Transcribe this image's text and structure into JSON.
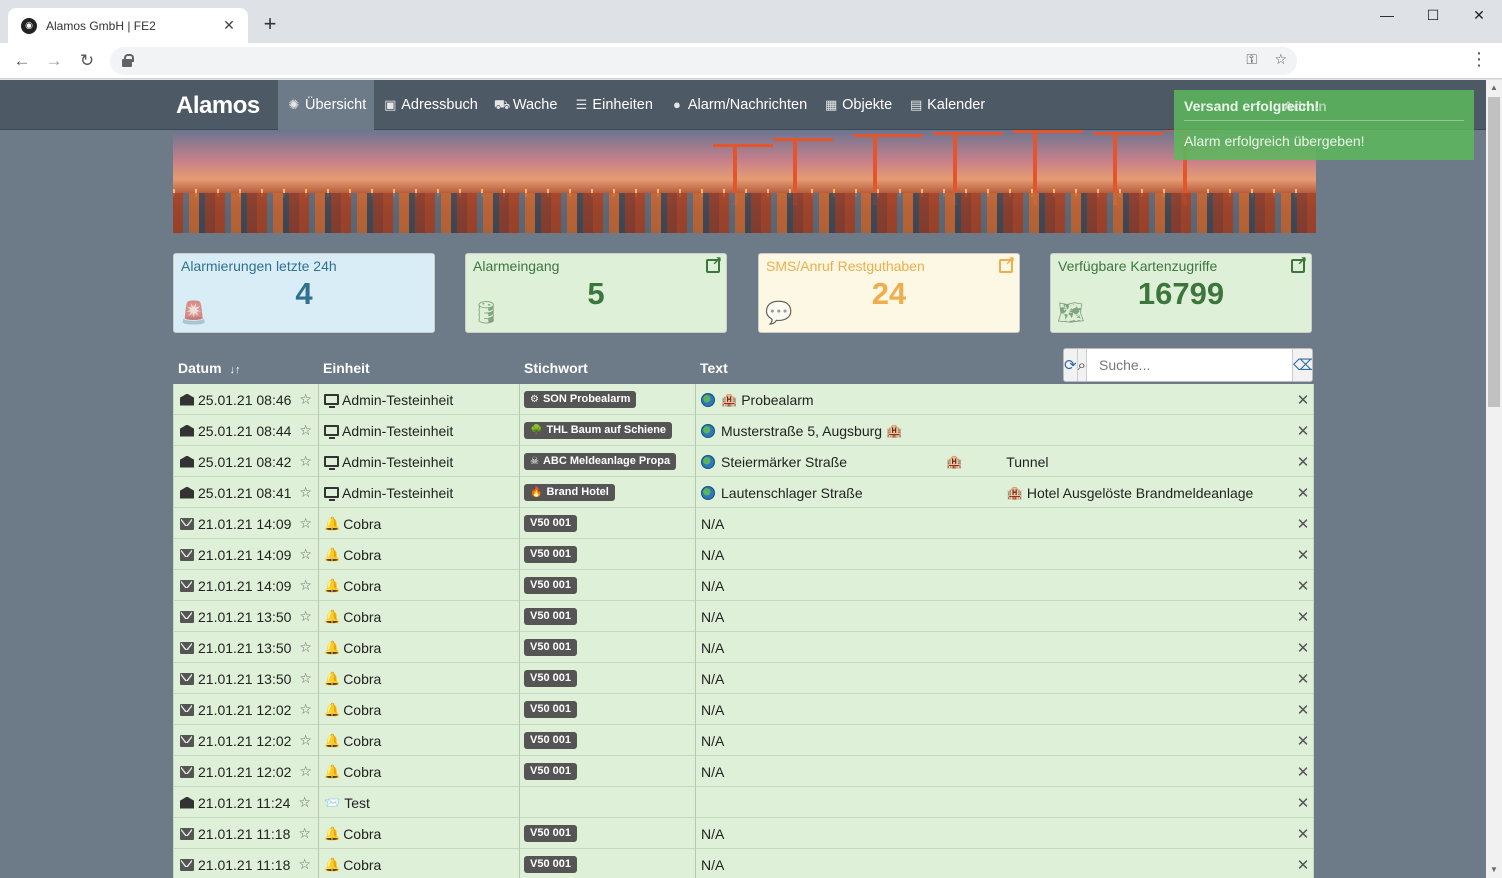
{
  "browser": {
    "tab_title": "Alamos GmbH | FE2",
    "new_tab": "+",
    "minimize": "—",
    "maximize": "☐",
    "close": "✕"
  },
  "app": {
    "brand": "Alamos",
    "nav": [
      {
        "label": "Übersicht",
        "icon": "alarm-light-icon",
        "active": true
      },
      {
        "label": "Adressbuch",
        "icon": "contact-book-icon"
      },
      {
        "label": "Wache",
        "icon": "fire-truck-icon"
      },
      {
        "label": "Einheiten",
        "icon": "list-icon"
      },
      {
        "label": "Alarm/Nachrichten",
        "icon": "chat-icon"
      },
      {
        "label": "Objekte",
        "icon": "building-icon"
      },
      {
        "label": "Kalender",
        "icon": "calendar-icon"
      }
    ],
    "admin_label": "Admin",
    "toast": {
      "title": "Versand erfolgreich!",
      "message": "Alarm erfolgreich übergeben!"
    }
  },
  "panels": [
    {
      "label": "Alarmierungen letzte 24h",
      "value": "4",
      "bg": "#d9edf7",
      "fg": "#31708f",
      "icon": "siren-icon",
      "link": false
    },
    {
      "label": "Alarmeingang",
      "value": "5",
      "bg": "#dff0d8",
      "fg": "#3c763d",
      "icon": "database-icon",
      "link": true
    },
    {
      "label": "SMS/Anruf Restguthaben",
      "value": "24",
      "bg": "#fcf8e3",
      "fg": "#f0ad4e",
      "icon": "money-chat-icon",
      "link": true
    },
    {
      "label": "Verfügbare Kartenzugriffe",
      "value": "16799",
      "bg": "#dff0d8",
      "fg": "#3c763d",
      "icon": "map-icon",
      "link": true
    }
  ],
  "table": {
    "headers": {
      "date": "Datum",
      "sort": "↓↑",
      "unit": "Einheit",
      "keyword": "Stichwort",
      "text": "Text"
    },
    "search_placeholder": "Suche...",
    "rows": [
      {
        "type": "open",
        "date": "25.01.21 08:46",
        "unit_icon": "monitor",
        "unit": "Admin-Testeinheit",
        "kw_icon": "⚙",
        "keyword": "SON Probealarm",
        "globe": true,
        "text_a": "Probealarm",
        "bldg_before": true,
        "text_b": "",
        "gap": 0
      },
      {
        "type": "open",
        "date": "25.01.21 08:44",
        "unit_icon": "monitor",
        "unit": "Admin-Testeinheit",
        "kw_icon": "🌳",
        "keyword": "THL Baum auf Schiene",
        "globe": true,
        "text_a": "Musterstraße 5, Augsburg",
        "bldg_after": true,
        "text_b": "",
        "gap": 0
      },
      {
        "type": "open",
        "date": "25.01.21 08:42",
        "unit_icon": "monitor",
        "unit": "Admin-Testeinheit",
        "kw_icon": "☠",
        "keyword": "ABC Meldeanlage Propa",
        "globe": true,
        "text_a": "Steiermärker Straße",
        "bldg_mid": true,
        "text_b": "Tunnel",
        "gap": 1
      },
      {
        "type": "open",
        "date": "25.01.21 08:41",
        "unit_icon": "monitor",
        "unit": "Admin-Testeinheit",
        "kw_icon": "🔥",
        "keyword": "Brand Hotel",
        "globe": true,
        "text_a": "Lautenschlager Straße",
        "bldg_mid": true,
        "text_b": "Hotel Ausgelöste Brandmeldeanlage",
        "gap": 2
      },
      {
        "type": "mail",
        "date": "21.01.21 14:09",
        "unit_icon": "bell",
        "unit": "Cobra",
        "kw_icon": "",
        "keyword": "V50 001",
        "globe": false,
        "text_a": "N/A",
        "text_b": ""
      },
      {
        "type": "mail",
        "date": "21.01.21 14:09",
        "unit_icon": "bell",
        "unit": "Cobra",
        "kw_icon": "",
        "keyword": "V50 001",
        "globe": false,
        "text_a": "N/A",
        "text_b": ""
      },
      {
        "type": "mail",
        "date": "21.01.21 14:09",
        "unit_icon": "bell",
        "unit": "Cobra",
        "kw_icon": "",
        "keyword": "V50 001",
        "globe": false,
        "text_a": "N/A",
        "text_b": ""
      },
      {
        "type": "mail",
        "date": "21.01.21 13:50",
        "unit_icon": "bell",
        "unit": "Cobra",
        "kw_icon": "",
        "keyword": "V50 001",
        "globe": false,
        "text_a": "N/A",
        "text_b": ""
      },
      {
        "type": "mail",
        "date": "21.01.21 13:50",
        "unit_icon": "bell",
        "unit": "Cobra",
        "kw_icon": "",
        "keyword": "V50 001",
        "globe": false,
        "text_a": "N/A",
        "text_b": ""
      },
      {
        "type": "mail",
        "date": "21.01.21 13:50",
        "unit_icon": "bell",
        "unit": "Cobra",
        "kw_icon": "",
        "keyword": "V50 001",
        "globe": false,
        "text_a": "N/A",
        "text_b": ""
      },
      {
        "type": "mail",
        "date": "21.01.21 12:02",
        "unit_icon": "bell",
        "unit": "Cobra",
        "kw_icon": "",
        "keyword": "V50 001",
        "globe": false,
        "text_a": "N/A",
        "text_b": ""
      },
      {
        "type": "mail",
        "date": "21.01.21 12:02",
        "unit_icon": "bell",
        "unit": "Cobra",
        "kw_icon": "",
        "keyword": "V50 001",
        "globe": false,
        "text_a": "N/A",
        "text_b": ""
      },
      {
        "type": "mail",
        "date": "21.01.21 12:02",
        "unit_icon": "bell",
        "unit": "Cobra",
        "kw_icon": "",
        "keyword": "V50 001",
        "globe": false,
        "text_a": "N/A",
        "text_b": ""
      },
      {
        "type": "open",
        "date": "21.01.21 11:24",
        "unit_icon": "test",
        "unit": "Test",
        "kw_icon": "",
        "keyword": "",
        "globe": false,
        "text_a": "",
        "text_b": ""
      },
      {
        "type": "mail",
        "date": "21.01.21 11:18",
        "unit_icon": "bell",
        "unit": "Cobra",
        "kw_icon": "",
        "keyword": "V50 001",
        "globe": false,
        "text_a": "N/A",
        "text_b": ""
      },
      {
        "type": "mail",
        "date": "21.01.21 11:18",
        "unit_icon": "bell",
        "unit": "Cobra",
        "kw_icon": "",
        "keyword": "V50 001",
        "globe": false,
        "text_a": "N/A",
        "text_b": ""
      }
    ]
  }
}
